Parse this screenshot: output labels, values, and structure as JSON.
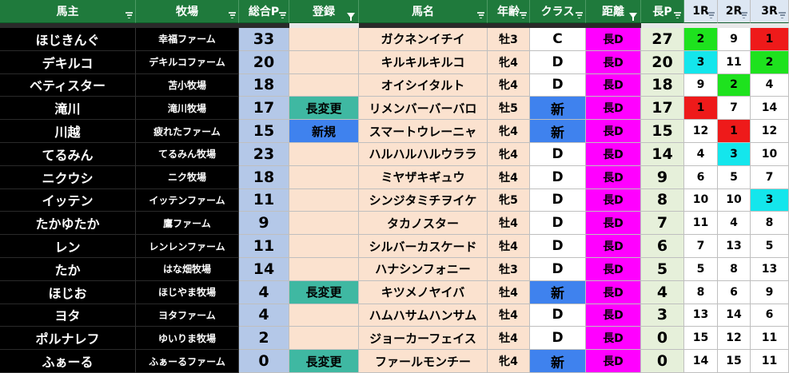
{
  "headers": {
    "owner": "馬主",
    "farm": "牧場",
    "total": "総合P",
    "register": "登録",
    "horse": "馬名",
    "age": "年齢",
    "class": "クラス",
    "distance": "距離",
    "long_p": "長P",
    "r1": "1R",
    "r2": "2R",
    "r3": "3R"
  },
  "colors": {
    "header_green": "#1f7a3c",
    "header_blue": "#dde7f3",
    "total_bg": "#b4c8e8",
    "peach_bg": "#fbe2cf",
    "change_teal": "#3fb8a2",
    "new_blue": "#3f82ee",
    "distance_magenta": "#ff00ff",
    "long_p_bg": "#e6f0da",
    "rank_green": "#1ee21e",
    "rank_cyan": "#14e6ec",
    "rank_red": "#ee1a1a"
  },
  "rows": [
    {
      "owner": "ほじきんぐ",
      "farm": "幸福ファーム",
      "total": "33",
      "register": "",
      "horse": "ガクネンイチイ",
      "age": "牡3",
      "class": "C",
      "distance": "長D",
      "long_p": "27",
      "r1": "2",
      "r2": "9",
      "r3": "1"
    },
    {
      "owner": "デキルコ",
      "farm": "デキルコファーム",
      "total": "20",
      "register": "",
      "horse": "キルキルキルコ",
      "age": "牝4",
      "class": "D",
      "distance": "長D",
      "long_p": "20",
      "r1": "3",
      "r2": "11",
      "r3": "2"
    },
    {
      "owner": "ベティスター",
      "farm": "苫小牧場",
      "total": "18",
      "register": "",
      "horse": "オイシイタルト",
      "age": "牝4",
      "class": "D",
      "distance": "長D",
      "long_p": "18",
      "r1": "9",
      "r2": "2",
      "r3": "4"
    },
    {
      "owner": "滝川",
      "farm": "滝川牧場",
      "total": "17",
      "register": "長変更",
      "horse": "リメンバーバーバロ",
      "age": "牡5",
      "class": "新",
      "distance": "長D",
      "long_p": "17",
      "r1": "1",
      "r2": "7",
      "r3": "14"
    },
    {
      "owner": "川越",
      "farm": "疲れたファーム",
      "total": "15",
      "register": "新規",
      "horse": "スマートウレーニャ",
      "age": "牝4",
      "class": "新",
      "distance": "長D",
      "long_p": "15",
      "r1": "12",
      "r2": "1",
      "r3": "12"
    },
    {
      "owner": "てるみん",
      "farm": "てるみん牧場",
      "total": "23",
      "register": "",
      "horse": "ハルハルハルウララ",
      "age": "牝4",
      "class": "D",
      "distance": "長D",
      "long_p": "14",
      "r1": "4",
      "r2": "3",
      "r3": "10"
    },
    {
      "owner": "ニクウシ",
      "farm": "ニク牧場",
      "total": "18",
      "register": "",
      "horse": "ミヤザキギュウ",
      "age": "牡4",
      "class": "D",
      "distance": "長D",
      "long_p": "9",
      "r1": "6",
      "r2": "5",
      "r3": "7"
    },
    {
      "owner": "イッテン",
      "farm": "イッテンファーム",
      "total": "11",
      "register": "",
      "horse": "シンジタミチヲイケ",
      "age": "牝5",
      "class": "D",
      "distance": "長D",
      "long_p": "8",
      "r1": "10",
      "r2": "10",
      "r3": "3"
    },
    {
      "owner": "たかゆたか",
      "farm": "鷹ファーム",
      "total": "9",
      "register": "",
      "horse": "タカノスター",
      "age": "牡4",
      "class": "D",
      "distance": "長D",
      "long_p": "7",
      "r1": "11",
      "r2": "4",
      "r3": "8"
    },
    {
      "owner": "レン",
      "farm": "レンレンファーム",
      "total": "11",
      "register": "",
      "horse": "シルバーカスケード",
      "age": "牡4",
      "class": "D",
      "distance": "長D",
      "long_p": "6",
      "r1": "7",
      "r2": "13",
      "r3": "5"
    },
    {
      "owner": "たか",
      "farm": "はな畑牧場",
      "total": "14",
      "register": "",
      "horse": "ハナシンフォニー",
      "age": "牡3",
      "class": "D",
      "distance": "長D",
      "long_p": "5",
      "r1": "5",
      "r2": "8",
      "r3": "13"
    },
    {
      "owner": "ほじお",
      "farm": "ほじやま牧場",
      "total": "4",
      "register": "長変更",
      "horse": "キツメノヤイバ",
      "age": "牡4",
      "class": "新",
      "distance": "長D",
      "long_p": "4",
      "r1": "8",
      "r2": "6",
      "r3": "9"
    },
    {
      "owner": "ヨタ",
      "farm": "ヨタファーム",
      "total": "4",
      "register": "",
      "horse": "ハムハサムハンサム",
      "age": "牡4",
      "class": "D",
      "distance": "長D",
      "long_p": "3",
      "r1": "13",
      "r2": "14",
      "r3": "6"
    },
    {
      "owner": "ポルナレフ",
      "farm": "ゆいりま牧場",
      "total": "2",
      "register": "",
      "horse": "ジョーカーフェイス",
      "age": "牡4",
      "class": "D",
      "distance": "長D",
      "long_p": "0",
      "r1": "15",
      "r2": "12",
      "r3": "11"
    },
    {
      "owner": "ふぁーる",
      "farm": "ふぁーるファーム",
      "total": "0",
      "register": "長変更",
      "horse": "ファールモンチー",
      "age": "牝4",
      "class": "新",
      "distance": "長D",
      "long_p": "0",
      "r1": "14",
      "r2": "15",
      "r3": "11"
    }
  ]
}
